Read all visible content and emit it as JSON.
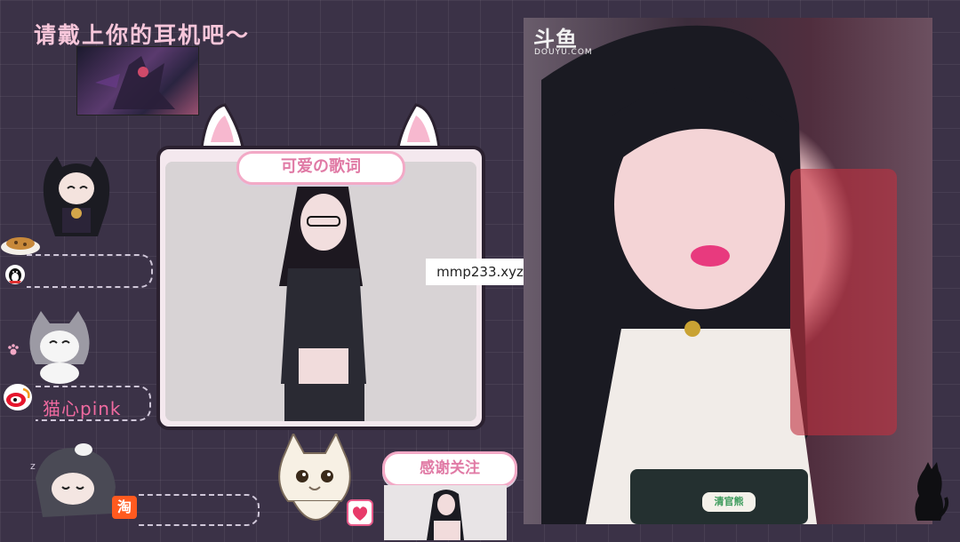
{
  "overlay": {
    "headline": "请戴上你的耳机吧～",
    "lyrics_label": "可爱の歌词",
    "thanks_label": "感谢关注",
    "nickname": "猫心pink",
    "watermark": "mmp233.xyz"
  },
  "stream": {
    "platform_name": "斗鱼",
    "platform_domain": "DOUYU.COM",
    "mic_label": "清官熊"
  },
  "icons": {
    "qq": "qq-penguin-icon",
    "weibo": "weibo-icon",
    "taobao": "taobao-icon",
    "gift": "gift-icon"
  },
  "colors": {
    "background": "#3b3247",
    "accent_pink": "#f3a9c6",
    "text_pink": "#e07aa5"
  }
}
